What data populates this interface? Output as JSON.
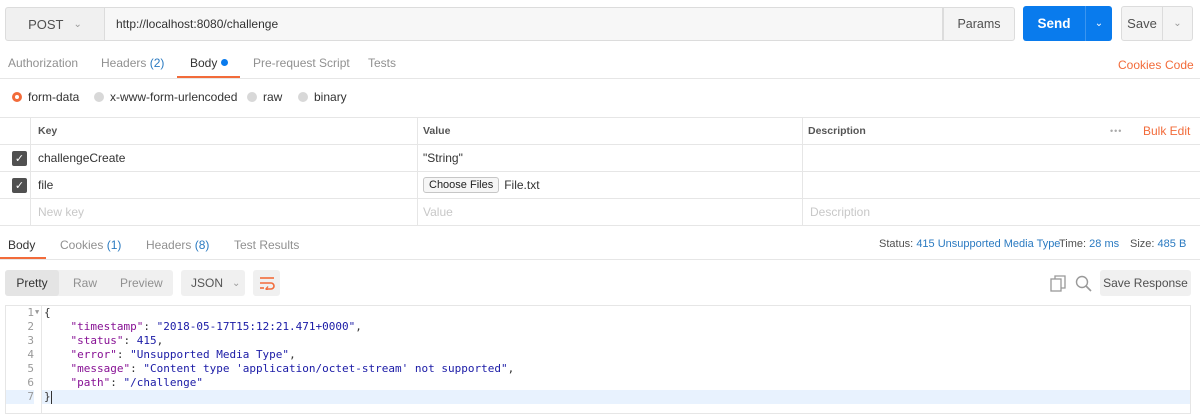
{
  "request": {
    "method": "POST",
    "url": "http://localhost:8080/challenge",
    "params_label": "Params",
    "send_label": "Send",
    "save_label": "Save"
  },
  "request_tabs": [
    {
      "label": "Authorization",
      "count": ""
    },
    {
      "label": "Headers",
      "count": "(2)"
    },
    {
      "label": "Body",
      "count": ""
    },
    {
      "label": "Pre-request Script",
      "count": ""
    },
    {
      "label": "Tests",
      "count": ""
    }
  ],
  "links": {
    "cookies": "Cookies",
    "code": "Code"
  },
  "body_types": [
    "form-data",
    "x-www-form-urlencoded",
    "raw",
    "binary"
  ],
  "body_type_selected": "form-data",
  "table": {
    "headers": {
      "key": "Key",
      "value": "Value",
      "description": "Description",
      "more": "•••",
      "bulk_edit": "Bulk Edit"
    },
    "rows": [
      {
        "key": "challengeCreate",
        "value": "\"String\"",
        "checked": true
      },
      {
        "key": "file",
        "value": "File.txt",
        "file_button": "Choose Files",
        "checked": true
      }
    ],
    "placeholders": {
      "key": "New key",
      "value": "Value",
      "description": "Description"
    }
  },
  "response_tabs": [
    {
      "label": "Body",
      "count": ""
    },
    {
      "label": "Cookies",
      "count": "(1)"
    },
    {
      "label": "Headers",
      "count": "(8)"
    },
    {
      "label": "Test Results",
      "count": ""
    }
  ],
  "status": {
    "status_label": "Status:",
    "status_value": "415 Unsupported Media Type",
    "time_label": "Time:",
    "time_value": "28 ms",
    "size_label": "Size:",
    "size_value": "485 B"
  },
  "response_toolbar": {
    "views": [
      "Pretty",
      "Raw",
      "Preview"
    ],
    "format": "JSON",
    "save_response": "Save Response"
  },
  "code_lines": [
    "1",
    "2",
    "3",
    "4",
    "5",
    "6",
    "7"
  ],
  "response_json": {
    "timestamp_key": "\"timestamp\"",
    "timestamp_val": "\"2018-05-17T15:12:21.471+0000\"",
    "status_key": "\"status\"",
    "status_val": "415",
    "error_key": "\"error\"",
    "error_val": "\"Unsupported Media Type\"",
    "message_key": "\"message\"",
    "message_val": "\"Content type 'application/octet-stream' not supported\"",
    "path_key": "\"path\"",
    "path_val": "\"/challenge\""
  },
  "colors": {
    "accent": "#f26b3a",
    "primary": "#097bed",
    "link": "#2a7ac1"
  }
}
